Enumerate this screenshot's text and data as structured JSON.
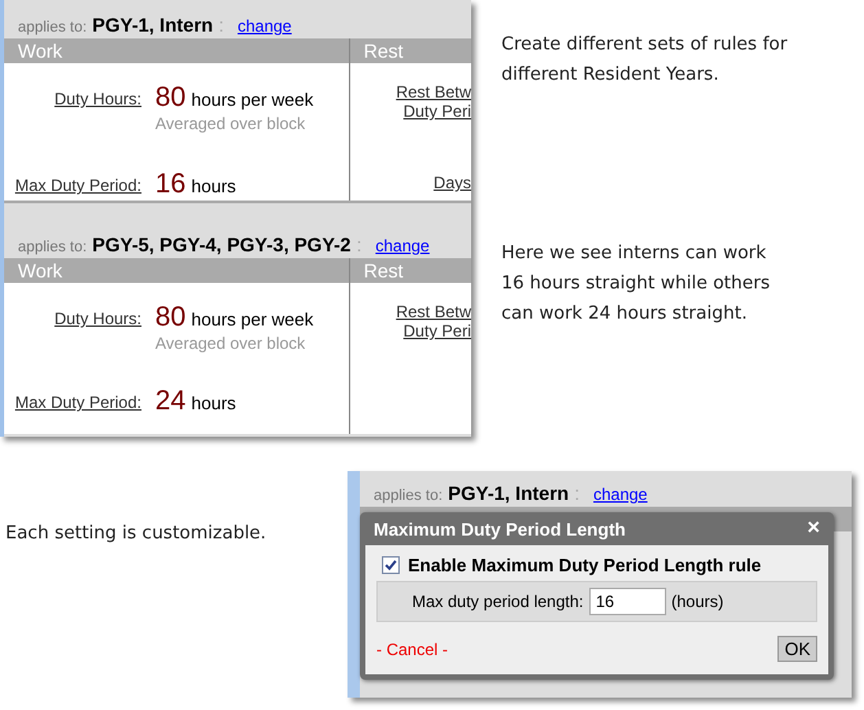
{
  "rule_sets": [
    {
      "applies_label": "applies to:",
      "groups": "PGY-1, Intern",
      "groups_suffix": ":",
      "change_link": "change",
      "columns": [
        "Work",
        "Rest"
      ],
      "work_rows": [
        {
          "label": "Duty Hours:",
          "value": "80",
          "unit": "hours per week",
          "note": "Averaged over block"
        },
        {
          "label": "Max Duty Period:",
          "value": "16",
          "unit": "hours"
        }
      ],
      "rest_links": [
        {
          "lines": [
            "Rest Betw",
            "Duty Peri"
          ]
        },
        {
          "lines": [
            "Days"
          ]
        }
      ]
    },
    {
      "applies_label": "applies to:",
      "groups": "PGY-5, PGY-4, PGY-3, PGY-2",
      "groups_suffix": ":",
      "change_link": "change",
      "columns": [
        "Work",
        "Rest"
      ],
      "work_rows": [
        {
          "label": "Duty Hours:",
          "value": "80",
          "unit": "hours per week",
          "note": "Averaged over block"
        },
        {
          "label": "Max Duty Period:",
          "value": "24",
          "unit": "hours"
        }
      ],
      "rest_links": [
        {
          "lines": [
            "Rest Betw",
            "Duty Peri"
          ]
        }
      ]
    }
  ],
  "notes": [
    {
      "lines": [
        "Create different sets of rules for",
        "different Resident Years."
      ]
    },
    {
      "lines": [
        "Here we see interns can work",
        "16 hours straight while others",
        "can work 24 hours straight."
      ]
    }
  ],
  "bottom_note": "Each setting is customizable.",
  "preview": {
    "applies_label": "applies to:",
    "groups": "PGY-1, Intern",
    "groups_suffix": ":",
    "change_link": "change"
  },
  "dialog": {
    "title": "Maximum Duty Period Length",
    "close": "×",
    "enable": {
      "label": "Enable Maximum Duty Period Length rule",
      "checked": true
    },
    "field_label": "Max duty period length:",
    "value": "16",
    "unit": "(hours)",
    "cancel": "- Cancel -",
    "ok": "OK"
  }
}
